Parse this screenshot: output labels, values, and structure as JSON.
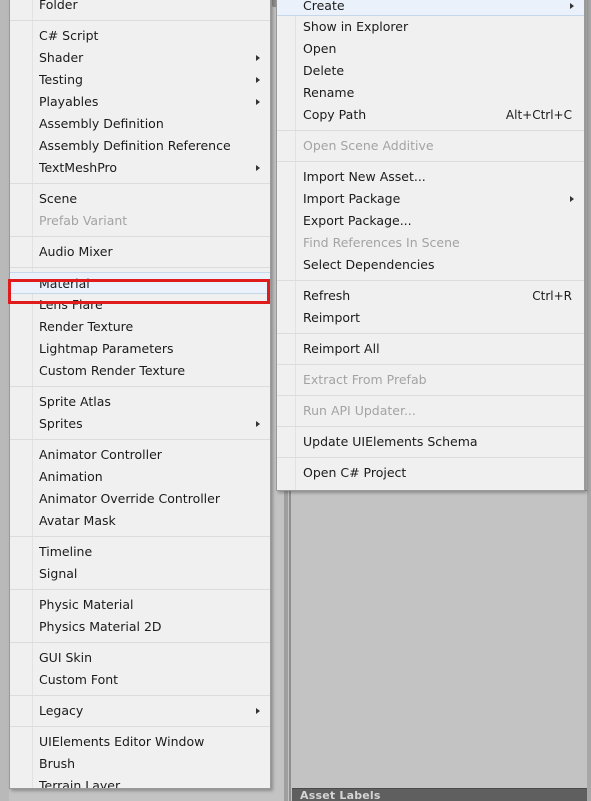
{
  "background": {
    "asset_labels_title": "Asset Labels"
  },
  "annotation": {
    "color": "#e01b1b",
    "target": "Material"
  },
  "colors": {
    "menu_background": "#f0f0f0",
    "menu_border": "#9a9a9a",
    "highlight": "#eaf1fa",
    "separator": "#dcdcdc",
    "text": "#1b1b1b",
    "disabled_text": "#a3a3a3",
    "editor_background": "#c3c3c3",
    "asset_labels_bar": "#5f5f5f"
  },
  "left_menu": {
    "name": "create-submenu",
    "groups": [
      {
        "items": [
          {
            "label": "Folder",
            "submenu": false,
            "disabled": false,
            "highlight": false
          }
        ]
      },
      {
        "items": [
          {
            "label": "C# Script",
            "submenu": false,
            "disabled": false,
            "highlight": false
          },
          {
            "label": "Shader",
            "submenu": true,
            "disabled": false,
            "highlight": false
          },
          {
            "label": "Testing",
            "submenu": true,
            "disabled": false,
            "highlight": false
          },
          {
            "label": "Playables",
            "submenu": true,
            "disabled": false,
            "highlight": false
          },
          {
            "label": "Assembly Definition",
            "submenu": false,
            "disabled": false,
            "highlight": false
          },
          {
            "label": "Assembly Definition Reference",
            "submenu": false,
            "disabled": false,
            "highlight": false
          },
          {
            "label": "TextMeshPro",
            "submenu": true,
            "disabled": false,
            "highlight": false
          }
        ]
      },
      {
        "items": [
          {
            "label": "Scene",
            "submenu": false,
            "disabled": false,
            "highlight": false
          },
          {
            "label": "Prefab Variant",
            "submenu": false,
            "disabled": true,
            "highlight": false
          }
        ]
      },
      {
        "items": [
          {
            "label": "Audio Mixer",
            "submenu": false,
            "disabled": false,
            "highlight": false
          }
        ]
      },
      {
        "items": [
          {
            "label": "Material",
            "submenu": false,
            "disabled": false,
            "highlight": true
          },
          {
            "label": "Lens Flare",
            "submenu": false,
            "disabled": false,
            "highlight": false
          },
          {
            "label": "Render Texture",
            "submenu": false,
            "disabled": false,
            "highlight": false
          },
          {
            "label": "Lightmap Parameters",
            "submenu": false,
            "disabled": false,
            "highlight": false
          },
          {
            "label": "Custom Render Texture",
            "submenu": false,
            "disabled": false,
            "highlight": false
          }
        ]
      },
      {
        "items": [
          {
            "label": "Sprite Atlas",
            "submenu": false,
            "disabled": false,
            "highlight": false
          },
          {
            "label": "Sprites",
            "submenu": true,
            "disabled": false,
            "highlight": false
          }
        ]
      },
      {
        "items": [
          {
            "label": "Animator Controller",
            "submenu": false,
            "disabled": false,
            "highlight": false
          },
          {
            "label": "Animation",
            "submenu": false,
            "disabled": false,
            "highlight": false
          },
          {
            "label": "Animator Override Controller",
            "submenu": false,
            "disabled": false,
            "highlight": false
          },
          {
            "label": "Avatar Mask",
            "submenu": false,
            "disabled": false,
            "highlight": false
          }
        ]
      },
      {
        "items": [
          {
            "label": "Timeline",
            "submenu": false,
            "disabled": false,
            "highlight": false
          },
          {
            "label": "Signal",
            "submenu": false,
            "disabled": false,
            "highlight": false
          }
        ]
      },
      {
        "items": [
          {
            "label": "Physic Material",
            "submenu": false,
            "disabled": false,
            "highlight": false
          },
          {
            "label": "Physics Material 2D",
            "submenu": false,
            "disabled": false,
            "highlight": false
          }
        ]
      },
      {
        "items": [
          {
            "label": "GUI Skin",
            "submenu": false,
            "disabled": false,
            "highlight": false
          },
          {
            "label": "Custom Font",
            "submenu": false,
            "disabled": false,
            "highlight": false
          }
        ]
      },
      {
        "items": [
          {
            "label": "Legacy",
            "submenu": true,
            "disabled": false,
            "highlight": false
          }
        ]
      },
      {
        "items": [
          {
            "label": "UIElements Editor Window",
            "submenu": false,
            "disabled": false,
            "highlight": false
          },
          {
            "label": "Brush",
            "submenu": false,
            "disabled": false,
            "highlight": false
          },
          {
            "label": "Terrain Layer",
            "submenu": false,
            "disabled": false,
            "highlight": false
          }
        ]
      }
    ]
  },
  "right_menu": {
    "name": "asset-context-menu",
    "groups": [
      {
        "items": [
          {
            "label": "Create",
            "shortcut": "",
            "submenu": true,
            "disabled": false,
            "highlight": true
          },
          {
            "label": "Show in Explorer",
            "shortcut": "",
            "submenu": false,
            "disabled": false,
            "highlight": false
          },
          {
            "label": "Open",
            "shortcut": "",
            "submenu": false,
            "disabled": false,
            "highlight": false
          },
          {
            "label": "Delete",
            "shortcut": "",
            "submenu": false,
            "disabled": false,
            "highlight": false
          },
          {
            "label": "Rename",
            "shortcut": "",
            "submenu": false,
            "disabled": false,
            "highlight": false
          },
          {
            "label": "Copy Path",
            "shortcut": "Alt+Ctrl+C",
            "submenu": false,
            "disabled": false,
            "highlight": false
          }
        ]
      },
      {
        "items": [
          {
            "label": "Open Scene Additive",
            "shortcut": "",
            "submenu": false,
            "disabled": true,
            "highlight": false
          }
        ]
      },
      {
        "items": [
          {
            "label": "Import New Asset...",
            "shortcut": "",
            "submenu": false,
            "disabled": false,
            "highlight": false
          },
          {
            "label": "Import Package",
            "shortcut": "",
            "submenu": true,
            "disabled": false,
            "highlight": false
          },
          {
            "label": "Export Package...",
            "shortcut": "",
            "submenu": false,
            "disabled": false,
            "highlight": false
          },
          {
            "label": "Find References In Scene",
            "shortcut": "",
            "submenu": false,
            "disabled": true,
            "highlight": false
          },
          {
            "label": "Select Dependencies",
            "shortcut": "",
            "submenu": false,
            "disabled": false,
            "highlight": false
          }
        ]
      },
      {
        "items": [
          {
            "label": "Refresh",
            "shortcut": "Ctrl+R",
            "submenu": false,
            "disabled": false,
            "highlight": false
          },
          {
            "label": "Reimport",
            "shortcut": "",
            "submenu": false,
            "disabled": false,
            "highlight": false
          }
        ]
      },
      {
        "items": [
          {
            "label": "Reimport All",
            "shortcut": "",
            "submenu": false,
            "disabled": false,
            "highlight": false
          }
        ]
      },
      {
        "items": [
          {
            "label": "Extract From Prefab",
            "shortcut": "",
            "submenu": false,
            "disabled": true,
            "highlight": false
          }
        ]
      },
      {
        "items": [
          {
            "label": "Run API Updater...",
            "shortcut": "",
            "submenu": false,
            "disabled": true,
            "highlight": false
          }
        ]
      },
      {
        "items": [
          {
            "label": "Update UIElements Schema",
            "shortcut": "",
            "submenu": false,
            "disabled": false,
            "highlight": false
          }
        ]
      },
      {
        "items": [
          {
            "label": "Open C# Project",
            "shortcut": "",
            "submenu": false,
            "disabled": false,
            "highlight": false
          }
        ]
      }
    ]
  }
}
